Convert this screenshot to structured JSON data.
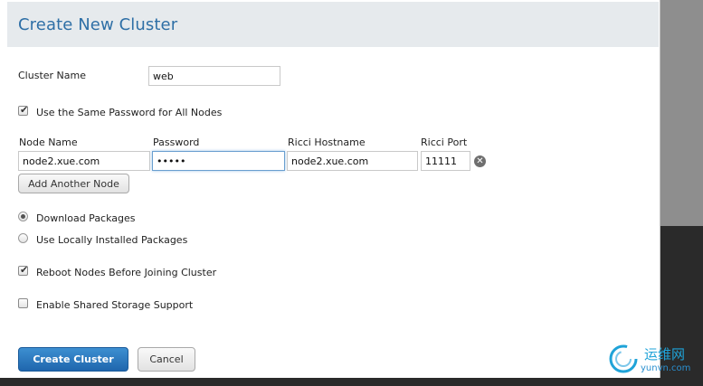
{
  "dialog": {
    "title": "Create New Cluster"
  },
  "cluster_name": {
    "label": "Cluster Name",
    "value": "web"
  },
  "same_password": {
    "label": "Use the Same Password for All Nodes",
    "checked": true
  },
  "nodes_table": {
    "columns": [
      "Node Name",
      "Password",
      "Ricci Hostname",
      "Ricci Port"
    ],
    "rows": [
      {
        "node_name": "node2.xue.com",
        "password": "•••••",
        "ricci_hostname": "node2.xue.com",
        "ricci_port": "11111"
      }
    ],
    "remove_glyph": "✕",
    "add_button": "Add Another Node"
  },
  "packages": {
    "options": [
      {
        "label": "Download Packages",
        "selected": true
      },
      {
        "label": "Use Locally Installed Packages",
        "selected": false
      }
    ]
  },
  "reboot_nodes": {
    "label": "Reboot Nodes Before Joining Cluster",
    "checked": true
  },
  "shared_storage": {
    "label": "Enable Shared Storage Support",
    "checked": false
  },
  "footer": {
    "create_button": "Create Cluster",
    "cancel_button": "Cancel"
  },
  "watermark": {
    "chinese": "运维网",
    "url": "yunvn.com"
  },
  "colors": {
    "title": "#2e6fa6",
    "primary_button": "#2a7bc4",
    "header_bg": "#e6eaed"
  },
  "icons": {
    "remove": "close-circle-icon",
    "check": "checkmark-icon"
  }
}
